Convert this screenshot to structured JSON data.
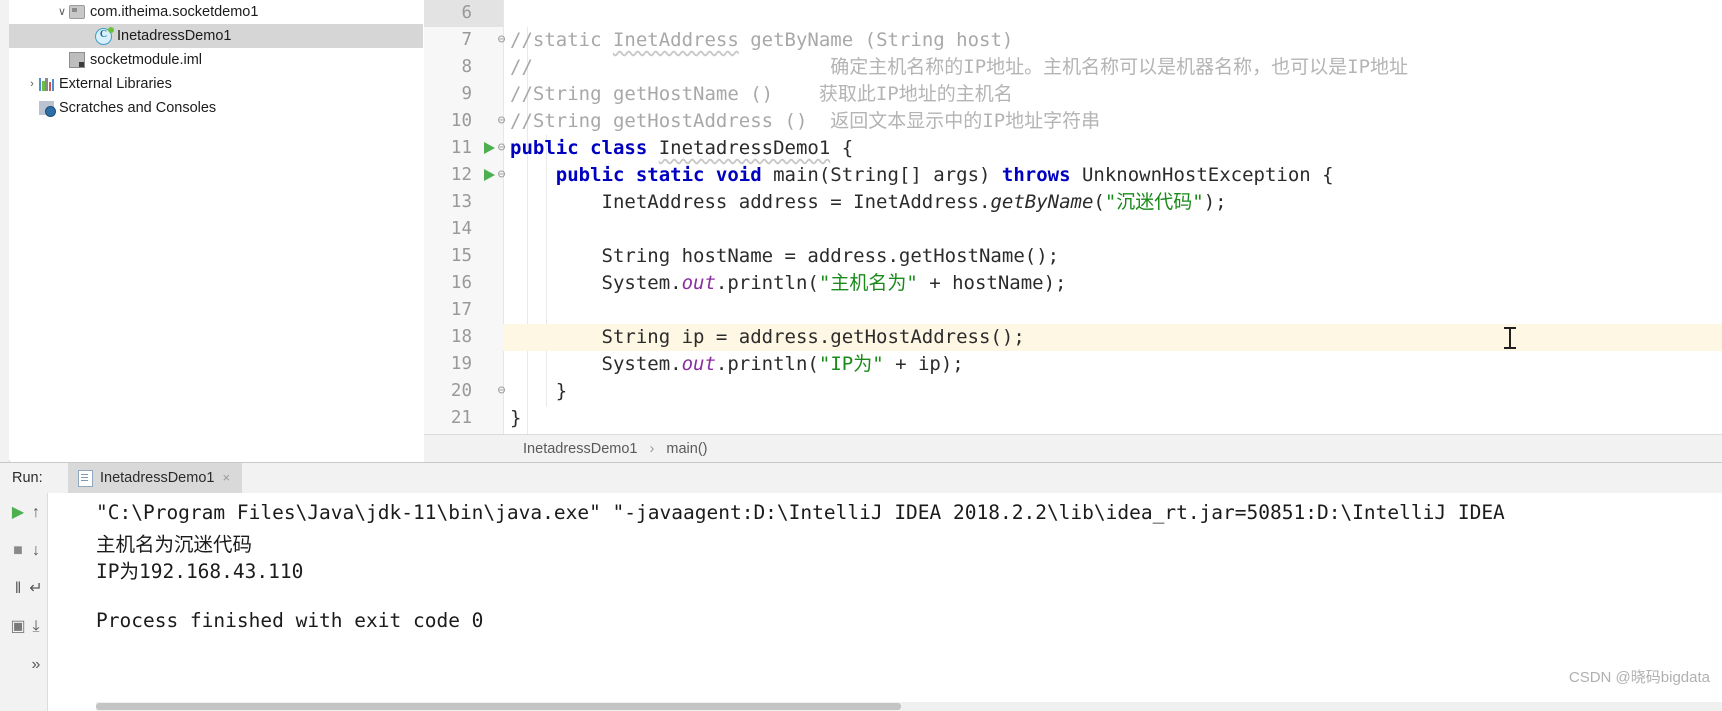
{
  "project_tree": {
    "items": [
      {
        "label": "com.itheima.socketdemo1",
        "icon": "package-icon",
        "indent": 62,
        "arrow": "∨",
        "selected": false
      },
      {
        "label": "InetadressDemo1",
        "icon": "java-class-icon",
        "indent": 88,
        "arrow": "",
        "selected": true
      },
      {
        "label": "socketmodule.iml",
        "icon": "iml-file-icon",
        "indent": 62,
        "arrow": "",
        "selected": false
      },
      {
        "label": "External Libraries",
        "icon": "library-icon",
        "indent": 32,
        "arrow": "›",
        "selected": false
      },
      {
        "label": "Scratches and Consoles",
        "icon": "scratches-icon",
        "indent": 32,
        "arrow": "",
        "selected": false
      }
    ]
  },
  "editor": {
    "lines": [
      {
        "num": "6",
        "fold": "",
        "run": false,
        "segments": []
      },
      {
        "num": "7",
        "fold": "⊖",
        "run": false,
        "segments": [
          {
            "cls": "cm",
            "text": "//static "
          },
          {
            "cls": "cm wavy",
            "text": "InetAddress"
          },
          {
            "cls": "cm",
            "text": " getByName (String host)"
          }
        ]
      },
      {
        "num": "8",
        "fold": "",
        "run": false,
        "segments": [
          {
            "cls": "cm",
            "text": "//"
          },
          {
            "cls": "cm-cn",
            "text": "                          确定主机名称的IP地址。主机名称可以是机器名称，也可以是IP地址"
          }
        ]
      },
      {
        "num": "9",
        "fold": "",
        "run": false,
        "segments": [
          {
            "cls": "cm",
            "text": "//String getHostName ()    "
          },
          {
            "cls": "cm-cn",
            "text": "获取此IP地址的主机名"
          }
        ]
      },
      {
        "num": "10",
        "fold": "⊖",
        "run": false,
        "segments": [
          {
            "cls": "cm",
            "text": "//String getHostAddress ()  "
          },
          {
            "cls": "cm-cn",
            "text": "返回文本显示中的IP地址字符串"
          }
        ]
      },
      {
        "num": "11",
        "fold": "⊖",
        "run": true,
        "segments": [
          {
            "cls": "kw",
            "text": "public class "
          },
          {
            "cls": "pl wavy",
            "text": "InetadressDemo1"
          },
          {
            "cls": "pl",
            "text": " {"
          }
        ]
      },
      {
        "num": "12",
        "fold": "⊖",
        "run": true,
        "segments": [
          {
            "cls": "pl",
            "text": "    "
          },
          {
            "cls": "kw",
            "text": "public static void "
          },
          {
            "cls": "pl",
            "text": "main(String[] args) "
          },
          {
            "cls": "kw",
            "text": "throws "
          },
          {
            "cls": "pl",
            "text": "UnknownHostException {"
          }
        ]
      },
      {
        "num": "13",
        "fold": "",
        "run": false,
        "segments": [
          {
            "cls": "pl",
            "text": "        InetAddress address = InetAddress."
          },
          {
            "cls": "mth",
            "text": "getByName"
          },
          {
            "cls": "pl",
            "text": "("
          },
          {
            "cls": "str",
            "text": "\"沉迷代码\""
          },
          {
            "cls": "pl",
            "text": ");"
          }
        ]
      },
      {
        "num": "14",
        "fold": "",
        "run": false,
        "segments": []
      },
      {
        "num": "15",
        "fold": "",
        "run": false,
        "segments": [
          {
            "cls": "pl",
            "text": "        String hostName = address.getHostName();"
          }
        ]
      },
      {
        "num": "16",
        "fold": "",
        "run": false,
        "segments": [
          {
            "cls": "pl",
            "text": "        System."
          },
          {
            "cls": "fld",
            "text": "out"
          },
          {
            "cls": "pl",
            "text": ".println("
          },
          {
            "cls": "str",
            "text": "\"主机名为\""
          },
          {
            "cls": "pl",
            "text": " + hostName);"
          }
        ]
      },
      {
        "num": "17",
        "fold": "",
        "run": false,
        "segments": []
      },
      {
        "num": "18",
        "fold": "",
        "run": false,
        "highlight": true,
        "segments": [
          {
            "cls": "pl",
            "text": "        String ip = address.getHostAddress();"
          }
        ]
      },
      {
        "num": "19",
        "fold": "",
        "run": false,
        "segments": [
          {
            "cls": "pl",
            "text": "        System."
          },
          {
            "cls": "fld",
            "text": "out"
          },
          {
            "cls": "pl",
            "text": ".println("
          },
          {
            "cls": "str",
            "text": "\"IP为\""
          },
          {
            "cls": "pl",
            "text": " + ip);"
          }
        ]
      },
      {
        "num": "20",
        "fold": "⊖",
        "run": false,
        "segments": [
          {
            "cls": "pl",
            "text": "    }"
          }
        ]
      },
      {
        "num": "21",
        "fold": "",
        "run": false,
        "segments": [
          {
            "cls": "pl",
            "text": "}"
          }
        ]
      }
    ]
  },
  "breadcrumb": {
    "class": "InetadressDemo1",
    "separator": "›",
    "method": "main()"
  },
  "run_panel": {
    "run_label": "Run:",
    "tab_title": "InetadressDemo1",
    "tab_close": "×",
    "side_buttons": [
      {
        "name": "rerun-button",
        "glyph": "▶",
        "color": "#4caf50"
      },
      {
        "name": "stop-button",
        "glyph": "■",
        "color": "#8a8a8a"
      },
      {
        "name": "pause-button",
        "glyph": "‖",
        "color": "#5a5a5a"
      },
      {
        "name": "screenshot-button",
        "glyph": "▣",
        "color": "#7a7a7a"
      },
      {
        "name": "scroll-up-button",
        "glyph": "↑",
        "color": "#5a5a5a"
      },
      {
        "name": "scroll-down-button",
        "glyph": "↓",
        "color": "#5a5a5a"
      },
      {
        "name": "soft-wrap-button",
        "glyph": "↵",
        "color": "#5a5a5a"
      },
      {
        "name": "print-button",
        "glyph": "⤓",
        "color": "#5a5a5a"
      },
      {
        "name": "more-button",
        "glyph": "»",
        "color": "#5a5a5a"
      }
    ],
    "console_lines": [
      "\"C:\\Program Files\\Java\\jdk-11\\bin\\java.exe\" \"-javaagent:D:\\IntelliJ IDEA 2018.2.2\\lib\\idea_rt.jar=50851:D:\\IntelliJ IDEA",
      "主机名为沉迷代码",
      "IP为192.168.43.110",
      "",
      "Process finished with exit code 0"
    ]
  },
  "watermark": "CSDN @晓码bigdata",
  "colors": {
    "keyword": "#0000c0",
    "string": "#1a8a1a",
    "comment": "#a8a8a8",
    "field": "#8a2fa0",
    "selection": "#d6d6d6",
    "line_highlight": "#fdf7e4"
  }
}
